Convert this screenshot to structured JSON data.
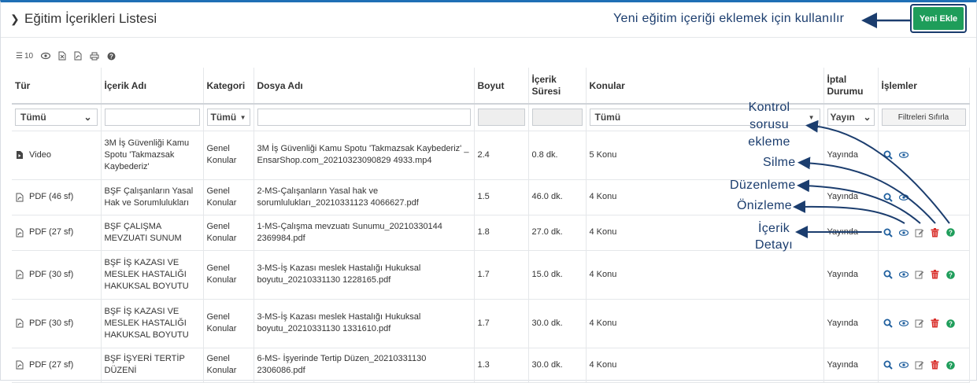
{
  "header": {
    "title": "Eğitim İçerikleri Listesi",
    "add_button": "Yeni Ekle"
  },
  "callouts": {
    "add": "Yeni eğitim içeriği eklemek için kullanılır",
    "control_1": "Kontrol",
    "control_2": "sorusu",
    "control_3": "ekleme",
    "delete": "Silme",
    "edit": "Düzenleme",
    "preview": "Önizleme",
    "detail_1": "İçerik",
    "detail_2": "Detayı"
  },
  "toolbar": {
    "page_size": "10"
  },
  "columns": {
    "type": "Tür",
    "name": "İçerik Adı",
    "category": "Kategori",
    "file": "Dosya Adı",
    "size": "Boyut",
    "duration_1": "İçerik",
    "duration_2": "Süresi",
    "topics": "Konular",
    "status_1": "İptal",
    "status_2": "Durumu",
    "actions": "İşlemler"
  },
  "filters": {
    "type": "Tümü",
    "category": "Tümü",
    "topics": "Tümü",
    "status": "Yayın",
    "reset": "Filtreleri Sıfırla"
  },
  "rows": [
    {
      "type": "Video",
      "name": "3M İş Güvenliği Kamu Spotu 'Takmazsak Kaybederiz'",
      "category": "Genel Konular",
      "file": "3M İş Güvenliği Kamu Spotu 'Takmazsak Kaybederiz' _ EnsarShop.com_20210323090829 4933.mp4",
      "size": "2.4",
      "duration": "0.8 dk.",
      "topics": "5 Konu",
      "status": "Yayında"
    },
    {
      "type": "PDF (46 sf)",
      "name": "BŞF Çalışanların Yasal Hak ve Sorumlulukları",
      "category": "Genel Konular",
      "file": "2-MS-Çalışanların Yasal hak ve sorumlulukları_20210331123 4066627.pdf",
      "size": "1.5",
      "duration": "46.0 dk.",
      "topics": "4 Konu",
      "status": "Yayında"
    },
    {
      "type": "PDF (27 sf)",
      "name": "BŞF ÇALIŞMA MEVZUATI SUNUM",
      "category": "Genel Konular",
      "file": "1-MS-Çalışma mevzuatı Sunumu_20210330144 2369984.pdf",
      "size": "1.8",
      "duration": "27.0 dk.",
      "topics": "4 Konu",
      "status": "Yayında"
    },
    {
      "type": "PDF (30 sf)",
      "name": "BŞF İŞ KAZASI VE MESLEK HASTALIĞI HAKUKSAL BOYUTU",
      "category": "Genel Konular",
      "file": "3-MS-İş Kazası meslek Hastalığı Hukuksal boyutu_20210331130 1228165.pdf",
      "size": "1.7",
      "duration": "15.0 dk.",
      "topics": "4 Konu",
      "status": "Yayında"
    },
    {
      "type": "PDF (30 sf)",
      "name": "BŞF İŞ KAZASI VE MESLEK HASTALIĞI HAKUKSAL BOYUTU",
      "category": "Genel Konular",
      "file": "3-MS-İş Kazası meslek Hastalığı Hukuksal boyutu_20210331130 1331610.pdf",
      "size": "1.7",
      "duration": "30.0 dk.",
      "topics": "4 Konu",
      "status": "Yayında"
    },
    {
      "type": "PDF (27 sf)",
      "name": "BŞF İŞYERİ TERTİP DÜZENİ",
      "category": "Genel Konular",
      "file": "6-MS- İşyerinde Tertip Düzen_20210331130 2306086.pdf",
      "size": "1.3",
      "duration": "30.0 dk.",
      "topics": "4 Konu",
      "status": "Yayında"
    }
  ],
  "colors": {
    "accent": "#1f6fb5",
    "add_button": "#1e9d5a",
    "callout": "#1b3d6e",
    "icon_blue": "#1f5f9e",
    "icon_red": "#d9302c",
    "icon_green": "#1e9d5a"
  }
}
